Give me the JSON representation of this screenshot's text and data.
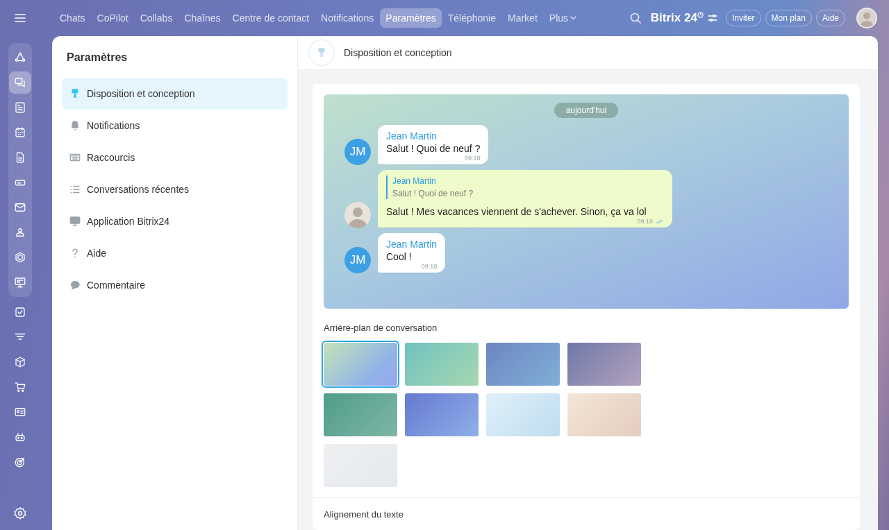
{
  "top_nav": {
    "items": [
      {
        "label": "Chats",
        "selected": false
      },
      {
        "label": "CoPilot",
        "selected": false
      },
      {
        "label": "Collabs",
        "selected": false
      },
      {
        "label": "Chaînes",
        "selected": false
      },
      {
        "label": "Centre de contact",
        "selected": false
      },
      {
        "label": "Notifications",
        "selected": false
      },
      {
        "label": "Paramètres",
        "selected": true
      },
      {
        "label": "Téléphonie",
        "selected": false
      },
      {
        "label": "Market",
        "selected": false
      },
      {
        "label": "Plus",
        "selected": false
      }
    ],
    "brand": "Bitrix 24",
    "buttons": [
      "Inviter",
      "Mon plan",
      "Aide"
    ]
  },
  "rail": [
    {
      "selected": false
    },
    {
      "selected": true
    },
    {
      "selected": false
    },
    {
      "selected": false
    },
    {
      "selected": false
    },
    {
      "selected": false
    },
    {
      "selected": false
    },
    {
      "selected": false
    },
    {
      "selected": false
    },
    {
      "selected": false
    },
    {
      "selected": false
    },
    {
      "selected": false
    },
    {
      "selected": false
    },
    {
      "selected": false
    },
    {
      "selected": false
    },
    {
      "selected": false
    },
    {
      "selected": false
    }
  ],
  "sidebar": {
    "title": "Paramètres",
    "items": [
      {
        "label": "Disposition et conception",
        "selected": true
      },
      {
        "label": "Notifications",
        "selected": false
      },
      {
        "label": "Raccourcis",
        "selected": false
      },
      {
        "label": "Conversations récentes",
        "selected": false
      },
      {
        "label": "Application Bitrix24",
        "selected": false
      },
      {
        "label": "Aide",
        "selected": false
      },
      {
        "label": "Commentaire",
        "selected": false
      }
    ]
  },
  "header": {
    "title": "Disposition et conception"
  },
  "preview": {
    "date": "aujourd'hui",
    "messages": [
      {
        "kind": "incoming",
        "avatar": "JM",
        "author": "Jean Martin",
        "text": "Salut ! Quoi de neuf ?",
        "time": "09:18"
      },
      {
        "kind": "own",
        "quote_author": "Jean Martin",
        "quote_text": "Salut ! Quoi de neuf ?",
        "text": "Salut ! Mes vacances viennent de s'achever. Sinon, ça va lol",
        "time": "09:18",
        "read": true
      },
      {
        "kind": "incoming",
        "avatar": "JM",
        "author": "Jean Martin",
        "text": "Cool !",
        "time": "09:18"
      }
    ]
  },
  "backgrounds": {
    "title": "Arrière-plan de conversation",
    "items": [
      {
        "selected": true
      },
      {
        "selected": false
      },
      {
        "selected": false
      },
      {
        "selected": false
      },
      {
        "selected": false
      },
      {
        "selected": false
      },
      {
        "selected": false
      },
      {
        "selected": false
      },
      {
        "selected": false
      }
    ]
  },
  "alignment": {
    "title": "Alignement du texte"
  }
}
